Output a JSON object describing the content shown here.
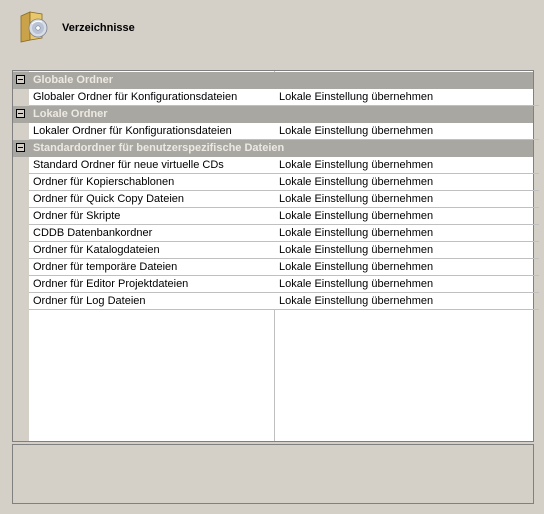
{
  "header": {
    "title": "Verzeichnisse",
    "icon": "folder-cd-icon"
  },
  "categories": [
    {
      "label": "Globale Ordner",
      "rows": [
        {
          "name": "Globaler Ordner für Konfigurationsdateien",
          "value": "Lokale Einstellung übernehmen"
        }
      ]
    },
    {
      "label": "Lokale Ordner",
      "rows": [
        {
          "name": "Lokaler Ordner für Konfigurationsdateien",
          "value": "Lokale Einstellung übernehmen"
        }
      ]
    },
    {
      "label": "Standardordner für benutzerspezifische Dateien",
      "rows": [
        {
          "name": "Standard Ordner für neue virtuelle CDs",
          "value": "Lokale Einstellung übernehmen"
        },
        {
          "name": "Ordner für Kopierschablonen",
          "value": "Lokale Einstellung übernehmen"
        },
        {
          "name": "Ordner für Quick Copy Dateien",
          "value": "Lokale Einstellung übernehmen"
        },
        {
          "name": "Ordner für Skripte",
          "value": "Lokale Einstellung übernehmen"
        },
        {
          "name": "CDDB Datenbankordner",
          "value": "Lokale Einstellung übernehmen"
        },
        {
          "name": "Ordner für Katalogdateien",
          "value": "Lokale Einstellung übernehmen"
        },
        {
          "name": "Ordner für temporäre Dateien",
          "value": "Lokale Einstellung übernehmen"
        },
        {
          "name": "Ordner für Editor Projektdateien",
          "value": "Lokale Einstellung übernehmen"
        },
        {
          "name": "Ordner für Log Dateien",
          "value": "Lokale Einstellung übernehmen"
        }
      ]
    }
  ]
}
